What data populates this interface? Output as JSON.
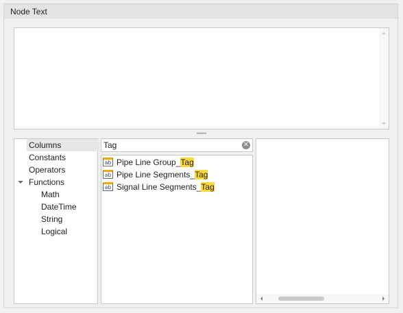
{
  "group": {
    "title": "Node Text"
  },
  "editor": {
    "value": ""
  },
  "tree": {
    "items": [
      {
        "label": "Columns",
        "selected": true
      },
      {
        "label": "Constants"
      },
      {
        "label": "Operators"
      },
      {
        "label": "Functions",
        "expanded": true
      },
      {
        "label": "Math"
      },
      {
        "label": "DateTime"
      },
      {
        "label": "String"
      },
      {
        "label": "Logical"
      }
    ]
  },
  "search": {
    "value": "Tag",
    "clear_icon": "clear-icon"
  },
  "list": {
    "items": [
      {
        "prefix": "Pipe Line Group_",
        "match": "Tag",
        "icon": "field-icon"
      },
      {
        "prefix": "Pipe Line Segments_",
        "match": "Tag",
        "icon": "field-icon"
      },
      {
        "prefix": "Signal Line Segments_",
        "match": "Tag",
        "icon": "field-icon"
      }
    ]
  },
  "description": {
    "text": ""
  },
  "colors": {
    "highlight": "#ffd83d",
    "selection": "#e6e6e6",
    "border": "#c8c8c8"
  }
}
